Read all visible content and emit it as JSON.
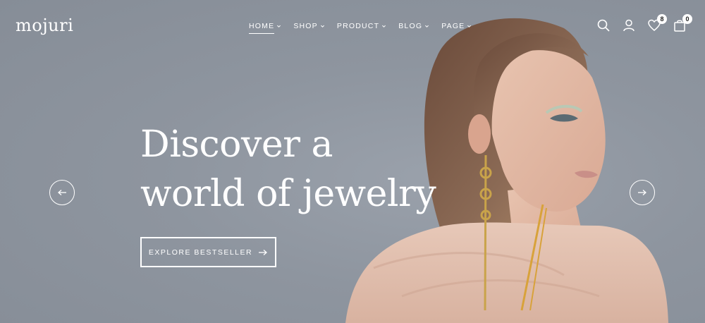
{
  "brand": {
    "logo_text": "mojuri"
  },
  "nav": {
    "items": [
      {
        "label": "HOME",
        "active": true
      },
      {
        "label": "SHOP",
        "active": false
      },
      {
        "label": "PRODUCT",
        "active": false
      },
      {
        "label": "BLOG",
        "active": false
      },
      {
        "label": "PAGE",
        "active": false
      }
    ]
  },
  "header": {
    "icons": [
      "search-icon",
      "user-icon",
      "heart-icon",
      "bag-icon"
    ],
    "wishlist_count": "8",
    "cart_count": "0"
  },
  "hero": {
    "headline_line1": "Discover a",
    "headline_line2": "world of jewelry",
    "cta_label": "EXPLORE BESTSELLER"
  },
  "colors": {
    "background": "#8f96a0",
    "text": "#ffffff"
  }
}
